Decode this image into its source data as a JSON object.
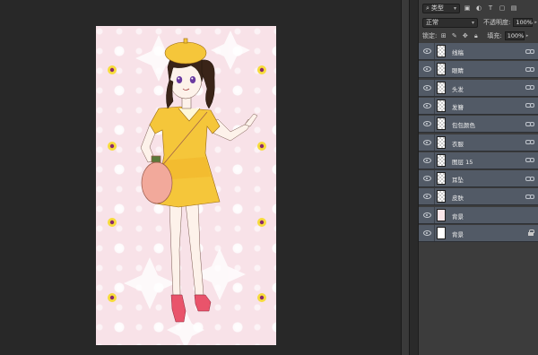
{
  "layers_panel": {
    "filter": {
      "label": "类型"
    },
    "blend_mode": "正常",
    "opacity": {
      "label": "不透明度:",
      "value": "100%"
    },
    "lock": {
      "label": "锁定:"
    },
    "fill": {
      "label": "填充:",
      "value": "100%"
    },
    "layers": [
      {
        "name": "线稿",
        "thumb": "transparent",
        "visible": true,
        "suffix": "link"
      },
      {
        "name": "眼睛",
        "thumb": "transparent",
        "visible": true,
        "suffix": "link"
      },
      {
        "name": "头发",
        "thumb": "transparent",
        "visible": true,
        "suffix": "link"
      },
      {
        "name": "发簪",
        "thumb": "transparent",
        "visible": true,
        "suffix": "link"
      },
      {
        "name": "包包颜色",
        "thumb": "transparent",
        "visible": true,
        "suffix": "link"
      },
      {
        "name": "衣服",
        "thumb": "transparent",
        "visible": true,
        "suffix": "link"
      },
      {
        "name": "图层 15",
        "thumb": "transparent",
        "visible": true,
        "suffix": "link"
      },
      {
        "name": "耳坠",
        "thumb": "transparent",
        "visible": true,
        "suffix": "link"
      },
      {
        "name": "皮肤",
        "thumb": "transparent",
        "visible": true,
        "suffix": "link"
      },
      {
        "name": "背景",
        "thumb": "pink",
        "visible": true,
        "suffix": "none"
      },
      {
        "name": "背景",
        "thumb": "white",
        "visible": true,
        "suffix": "lock"
      }
    ]
  },
  "canvas": {
    "background_color": "#f8e2e8",
    "dress_color": "#f5c63a",
    "bag_color": "#f2a99b",
    "hair_color": "#3a2418",
    "shoe_color": "#e9546b"
  }
}
